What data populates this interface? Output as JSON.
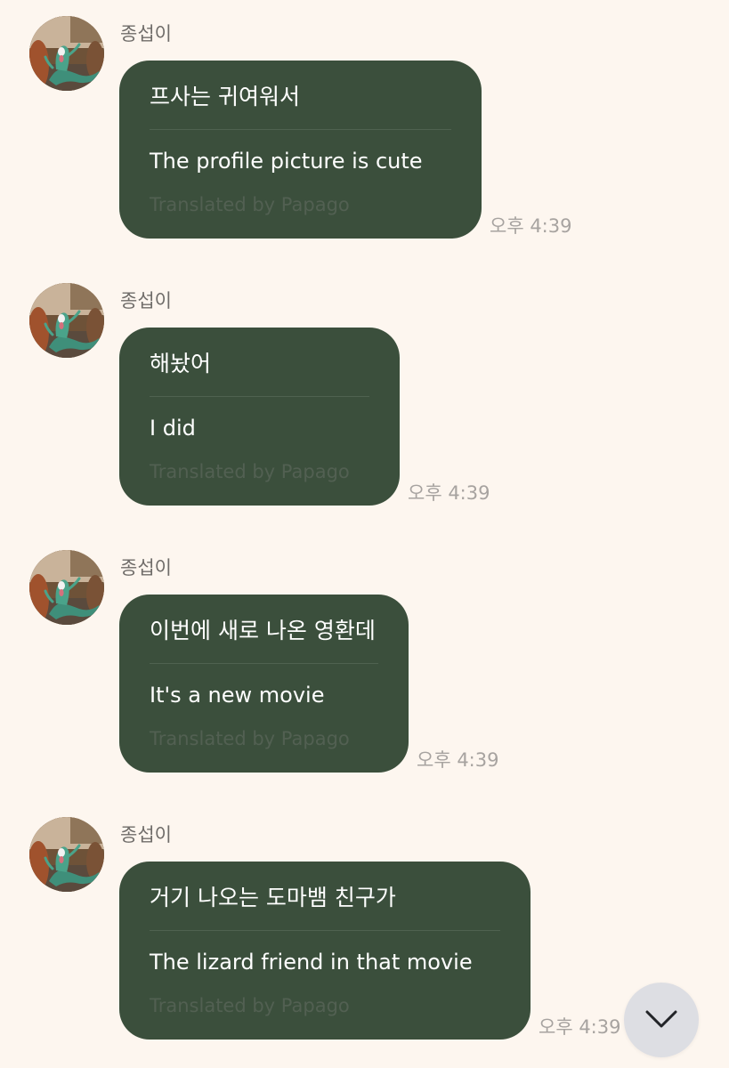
{
  "colors": {
    "background": "#fdf6ef",
    "bubble": "#3b4f3c",
    "bubble_text": "#ffffff",
    "credit_text": "#526052",
    "timestamp": "#a7a3a0",
    "sender": "#6f6c69",
    "scroll_button": "#dadce2"
  },
  "messages": [
    {
      "sender": "종섭이",
      "original": "프사는 귀여워서",
      "translation": "The profile picture is cute",
      "credit": "Translated by Papago",
      "time": "오후 4:39",
      "avatar_icon": "lizard-avatar-icon"
    },
    {
      "sender": "종섭이",
      "original": "해놨어",
      "translation": "I did",
      "credit": "Translated by Papago",
      "time": "오후 4:39",
      "avatar_icon": "lizard-avatar-icon"
    },
    {
      "sender": "종섭이",
      "original": "이번에 새로 나온 영환데",
      "translation": "It's a new movie",
      "credit": "Translated by Papago",
      "time": "오후 4:39",
      "avatar_icon": "lizard-avatar-icon"
    },
    {
      "sender": "종섭이",
      "original": "거기 나오는 도마뱀 친구가",
      "translation": "The lizard friend in that movie",
      "credit": "Translated by Papago",
      "time": "오후 4:39",
      "avatar_icon": "lizard-avatar-icon"
    }
  ],
  "scroll_button": {
    "icon": "chevron-down-icon"
  }
}
